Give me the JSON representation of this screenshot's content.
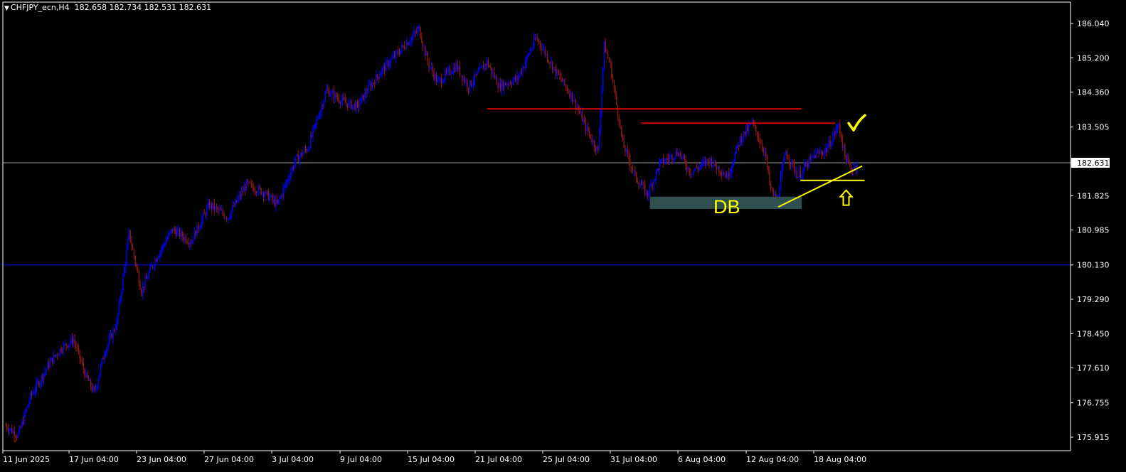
{
  "header": {
    "symbol": "CHFJPY_ecn,H4",
    "ohlc": "182.658 182.734 182.531 182.631"
  },
  "colors": {
    "background": "#000000",
    "axis": "#ffffff",
    "bull": "#0000ff",
    "bear": "#8b1a1a",
    "current_price_line": "#9a9a9a",
    "horizontal_blue": "#0000cc",
    "resistance": "#cc0000",
    "annotation": "#ffff00",
    "db_box": "#2f4f4f"
  },
  "chart_data": {
    "type": "candlestick",
    "title": "",
    "xlabel": "",
    "ylabel": "",
    "ylim": [
      175.6,
      186.4
    ],
    "y_ticks": [
      "186.040",
      "185.200",
      "184.360",
      "183.505",
      "182.631",
      "181.825",
      "180.985",
      "180.130",
      "179.290",
      "178.450",
      "177.610",
      "176.755",
      "175.915"
    ],
    "x_ticks": [
      "11 Jun 2025",
      "17 Jun 04:00",
      "23 Jun 04:00",
      "27 Jun 04:00",
      "3 Jul 04:00",
      "9 Jul 04:00",
      "15 Jul 04:00",
      "21 Jul 04:00",
      "25 Jul 04:00",
      "31 Jul 04:00",
      "6 Aug 04:00",
      "12 Aug 04:00",
      "18 Aug 04:00"
    ],
    "current_price": 182.631,
    "anchors": [
      [
        0,
        176.2
      ],
      [
        10,
        175.95
      ],
      [
        20,
        176.9
      ],
      [
        35,
        177.7
      ],
      [
        45,
        178.1
      ],
      [
        55,
        178.3
      ],
      [
        65,
        177.4
      ],
      [
        72,
        177.0
      ],
      [
        80,
        178.0
      ],
      [
        90,
        178.7
      ],
      [
        100,
        180.9
      ],
      [
        110,
        179.5
      ],
      [
        120,
        180.2
      ],
      [
        135,
        181.0
      ],
      [
        150,
        180.7
      ],
      [
        165,
        181.6
      ],
      [
        180,
        181.3
      ],
      [
        195,
        182.1
      ],
      [
        210,
        181.9
      ],
      [
        220,
        181.6
      ],
      [
        235,
        182.7
      ],
      [
        245,
        183.0
      ],
      [
        260,
        184.4
      ],
      [
        275,
        184.1
      ],
      [
        285,
        184.0
      ],
      [
        295,
        184.5
      ],
      [
        305,
        184.9
      ],
      [
        320,
        185.4
      ],
      [
        335,
        185.9
      ],
      [
        342,
        185.1
      ],
      [
        350,
        184.6
      ],
      [
        365,
        185.0
      ],
      [
        375,
        184.5
      ],
      [
        390,
        185.1
      ],
      [
        400,
        184.5
      ],
      [
        415,
        184.7
      ],
      [
        430,
        185.7
      ],
      [
        445,
        184.9
      ],
      [
        460,
        184.2
      ],
      [
        470,
        183.5
      ],
      [
        480,
        182.9
      ],
      [
        485,
        185.5
      ],
      [
        490,
        185.0
      ],
      [
        500,
        183.1
      ],
      [
        510,
        182.3
      ],
      [
        520,
        181.85
      ],
      [
        530,
        182.6
      ],
      [
        545,
        182.9
      ],
      [
        555,
        182.4
      ],
      [
        570,
        182.7
      ],
      [
        585,
        182.3
      ],
      [
        595,
        183.2
      ],
      [
        605,
        183.6
      ],
      [
        615,
        182.9
      ],
      [
        620,
        181.95
      ],
      [
        625,
        181.7
      ],
      [
        632,
        182.9
      ],
      [
        642,
        182.3
      ],
      [
        655,
        182.8
      ],
      [
        665,
        182.95
      ],
      [
        675,
        183.55
      ],
      [
        680,
        182.8
      ],
      [
        685,
        182.45
      ],
      [
        690,
        182.6
      ]
    ],
    "annotations": {
      "resistance_lines": [
        {
          "from_bar": 390,
          "to_bar": 645,
          "price": 183.95
        },
        {
          "from_bar": 515,
          "to_bar": 672,
          "price": 183.6
        }
      ],
      "horizontal_line": {
        "price": 180.13
      },
      "support_zone": {
        "label": "DB",
        "from_bar": 522,
        "to_bar": 645,
        "price_high": 181.8,
        "price_low": 181.5
      },
      "trendline": {
        "from": [
          626,
          181.55
        ],
        "to": [
          694,
          182.55
        ]
      },
      "neckline": {
        "from_bar": 644,
        "to_bar": 696,
        "price": 182.2
      },
      "checkmark": {
        "bar": 683,
        "price": 183.6
      },
      "up_arrow": {
        "bar": 681,
        "price": 181.75
      }
    }
  }
}
